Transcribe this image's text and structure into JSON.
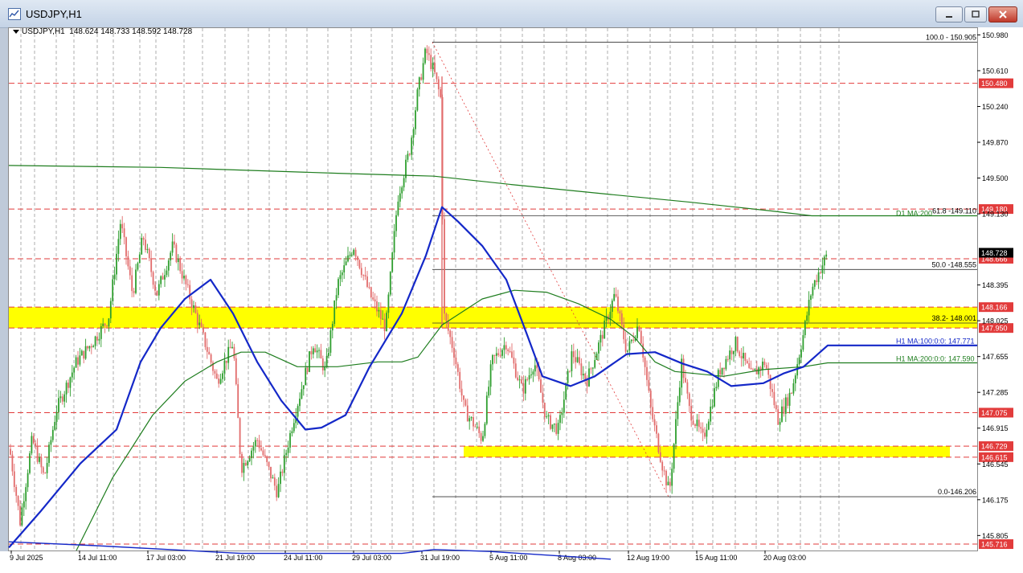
{
  "window": {
    "title": "USDJPY,H1",
    "chart_header": "USDJPY,H1  148.624 148.733 148.592 148.728"
  },
  "chart_data": {
    "type": "candlestick",
    "symbol": "USDJPY",
    "timeframe": "H1",
    "ohlc_header": {
      "open": 148.624,
      "high": 148.733,
      "low": 148.592,
      "close": 148.728
    },
    "current_price": "148.728",
    "ylim": [
      145.65,
      151.05
    ],
    "price_ticks": [
      "150.980",
      "150.610",
      "150.240",
      "149.870",
      "149.500",
      "149.130",
      "148.395",
      "148.025",
      "147.655",
      "147.285",
      "146.915",
      "146.545",
      "146.175",
      "145.805"
    ],
    "x_labels": [
      "9 Jul 2025",
      "14 Jul 11:00",
      "17 Jul 03:00",
      "21 Jul 19:00",
      "24 Jul 11:00",
      "29 Jul 03:00",
      "31 Jul 19:00",
      "5 Aug 11:00",
      "8 Aug 03:00",
      "12 Aug 19:00",
      "15 Aug 11:00",
      "20 Aug 03:00"
    ],
    "horizontal_levels": [
      {
        "price": 150.48,
        "label": "150.480",
        "color": "#e23b3b"
      },
      {
        "price": 149.18,
        "label": "149.180",
        "color": "#e23b3b"
      },
      {
        "price": 148.666,
        "label": "148.666",
        "color": "#e23b3b"
      },
      {
        "price": 148.166,
        "label": "148.166",
        "color": "#e23b3b"
      },
      {
        "price": 147.95,
        "label": "147.950",
        "color": "#e23b3b"
      },
      {
        "price": 147.075,
        "label": "147.075",
        "color": "#e23b3b"
      },
      {
        "price": 146.729,
        "label": "146.729",
        "color": "#e23b3b"
      },
      {
        "price": 146.615,
        "label": "146.615",
        "color": "#e23b3b"
      },
      {
        "price": 145.716,
        "label": "145.716",
        "color": "#e23b3b"
      }
    ],
    "zones": [
      {
        "from": 147.95,
        "to": 148.166,
        "color": "#ffff00"
      },
      {
        "from": 146.615,
        "to": 146.729,
        "color": "#ffff00"
      }
    ],
    "fibonacci": {
      "high": 150.905,
      "low": 146.206,
      "levels": [
        {
          "price": 150.905,
          "label": "100.0 - 150.905"
        },
        {
          "price": 149.11,
          "label": "61.8 -149.110"
        },
        {
          "price": 148.555,
          "label": "50.0 -148.555"
        },
        {
          "price": 148.001,
          "label": "38.2- 148.001"
        },
        {
          "price": 146.206,
          "label": "0.0-146.206"
        }
      ]
    },
    "moving_averages": [
      {
        "label": "D1 MA:200",
        "value": 149.11,
        "color": "#1e7d1e"
      },
      {
        "label": "H1 MA:100:0:0: 147.771",
        "value": 147.771,
        "color": "#1428c8"
      },
      {
        "label": "H1 MA:200:0:0: 147.590",
        "value": 147.59,
        "color": "#1e7d1e"
      }
    ],
    "colors": {
      "bull": "#2e9e2e",
      "bear": "#e26b6b",
      "grid": "#9a9a9a",
      "ma100": "#1428c8",
      "ma200": "#1e7d1e"
    }
  }
}
